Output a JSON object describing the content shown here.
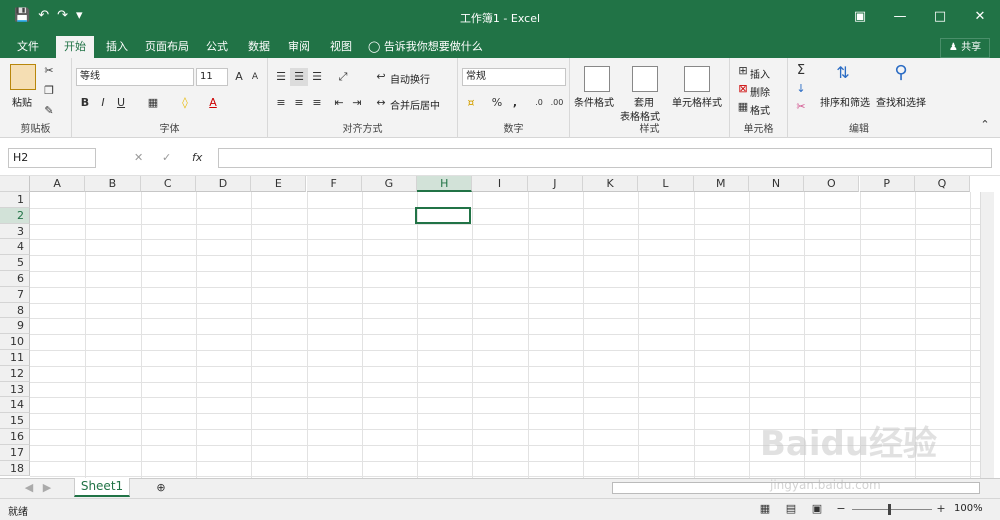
{
  "titlebar": {
    "title": "工作簿1 - Excel",
    "qat": [
      "save-icon",
      "undo-icon",
      "redo-icon",
      "customize-icon"
    ],
    "share_label": "共享"
  },
  "tabs": [
    {
      "label": "文件"
    },
    {
      "label": "开始"
    },
    {
      "label": "插入"
    },
    {
      "label": "页面布局"
    },
    {
      "label": "公式"
    },
    {
      "label": "数据"
    },
    {
      "label": "审阅"
    },
    {
      "label": "视图"
    }
  ],
  "tellme": "告诉我你想要做什么",
  "ribbon": {
    "clipboard": {
      "label": "剪贴板",
      "paste": "粘贴"
    },
    "font": {
      "label": "字体",
      "font_name": "等线",
      "font_size": "11",
      "bold": "B",
      "italic": "I",
      "underline": "U",
      "grow": "A",
      "shrink": "A",
      "font_color": "A"
    },
    "alignment": {
      "label": "对齐方式",
      "wrap": "自动换行",
      "merge": "合并后居中"
    },
    "number": {
      "label": "数字",
      "format": "常规",
      "percent": "%",
      "comma": ","
    },
    "styles": {
      "label": "样式",
      "cond": "条件格式",
      "table_a": "套用",
      "table_b": "表格格式",
      "cell_styles": "单元格样式"
    },
    "cells": {
      "label": "单元格",
      "insert": "插入",
      "delete": "删除",
      "format": "格式"
    },
    "editing": {
      "label": "编辑",
      "sum": "Σ",
      "sort": "排序和筛选",
      "find": "查找和选择"
    }
  },
  "formula_bar": {
    "name_box": "H2",
    "fx": "fx"
  },
  "columns": [
    "A",
    "B",
    "C",
    "D",
    "E",
    "F",
    "G",
    "H",
    "I",
    "J",
    "K",
    "L",
    "M",
    "N",
    "O",
    "P",
    "Q"
  ],
  "rows": [
    "1",
    "2",
    "3",
    "4",
    "5",
    "6",
    "7",
    "8",
    "9",
    "10",
    "11",
    "12",
    "13",
    "14",
    "15",
    "16",
    "17",
    "18"
  ],
  "sheet": {
    "name": "Sheet1"
  },
  "status": {
    "ready": "就绪",
    "zoom": "100%"
  },
  "watermark": {
    "main": "Baidu经验",
    "sub": "jingyan.baidu.com"
  },
  "colors": {
    "accent": "#217346"
  }
}
